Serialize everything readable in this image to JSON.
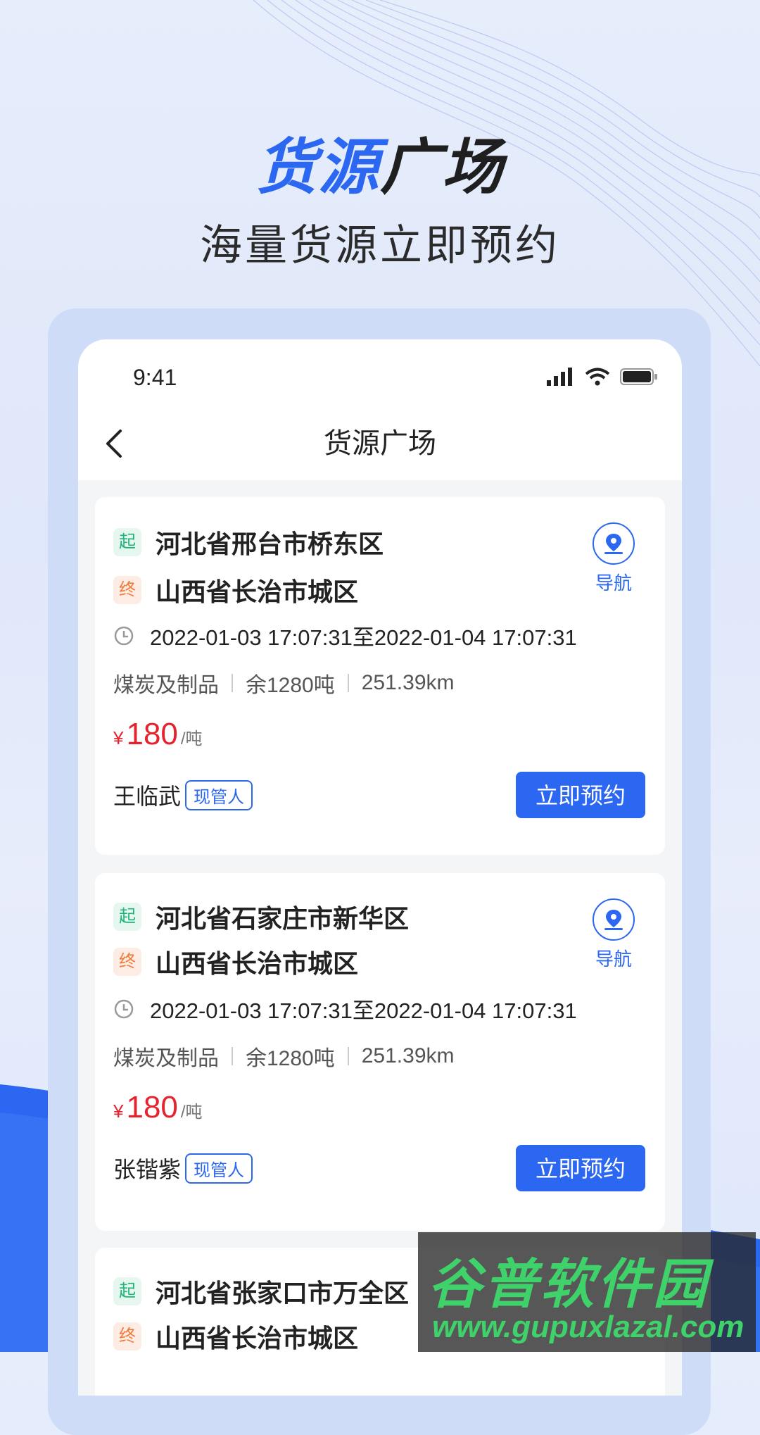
{
  "hero": {
    "title_blue": "货源",
    "title_dark": "广场",
    "subtitle": "海量货源立即预约"
  },
  "status_bar": {
    "time": "9:41",
    "icons": [
      "signal-icon",
      "wifi-icon",
      "battery-icon"
    ]
  },
  "navbar": {
    "title": "货源广场",
    "back_icon": "chevron-left-icon"
  },
  "cards": [
    {
      "start_tag": "起",
      "start": "河北省邢台市桥东区",
      "end_tag": "终",
      "end": "山西省长治市城区",
      "nav_label": "导航",
      "time_range": "2022-01-03 17:07:31至2022-01-04 17:07:31",
      "goods": "煤炭及制品",
      "remaining": "余1280吨",
      "distance": "251.39km",
      "price_symbol": "¥",
      "price": "180",
      "price_unit": "/吨",
      "owner": "王临武",
      "owner_tag": "现管人",
      "book_label": "立即预约"
    },
    {
      "start_tag": "起",
      "start": "河北省石家庄市新华区",
      "end_tag": "终",
      "end": "山西省长治市城区",
      "nav_label": "导航",
      "time_range": "2022-01-03 17:07:31至2022-01-04 17:07:31",
      "goods": "煤炭及制品",
      "remaining": "余1280吨",
      "distance": "251.39km",
      "price_symbol": "¥",
      "price": "180",
      "price_unit": "/吨",
      "owner": "张锴紫",
      "owner_tag": "现管人",
      "book_label": "立即预约"
    },
    {
      "start_tag": "起",
      "start": "河北省张家口市万全区",
      "end_tag": "终",
      "end": "山西省长治市城区"
    }
  ],
  "watermark": {
    "title": "谷普软件园",
    "url": "www.gupuxlazal.com"
  },
  "colors": {
    "accent": "#2b67f0",
    "price": "#e5232e",
    "start_tag": "#1fb57a",
    "end_tag": "#f07a3a"
  }
}
